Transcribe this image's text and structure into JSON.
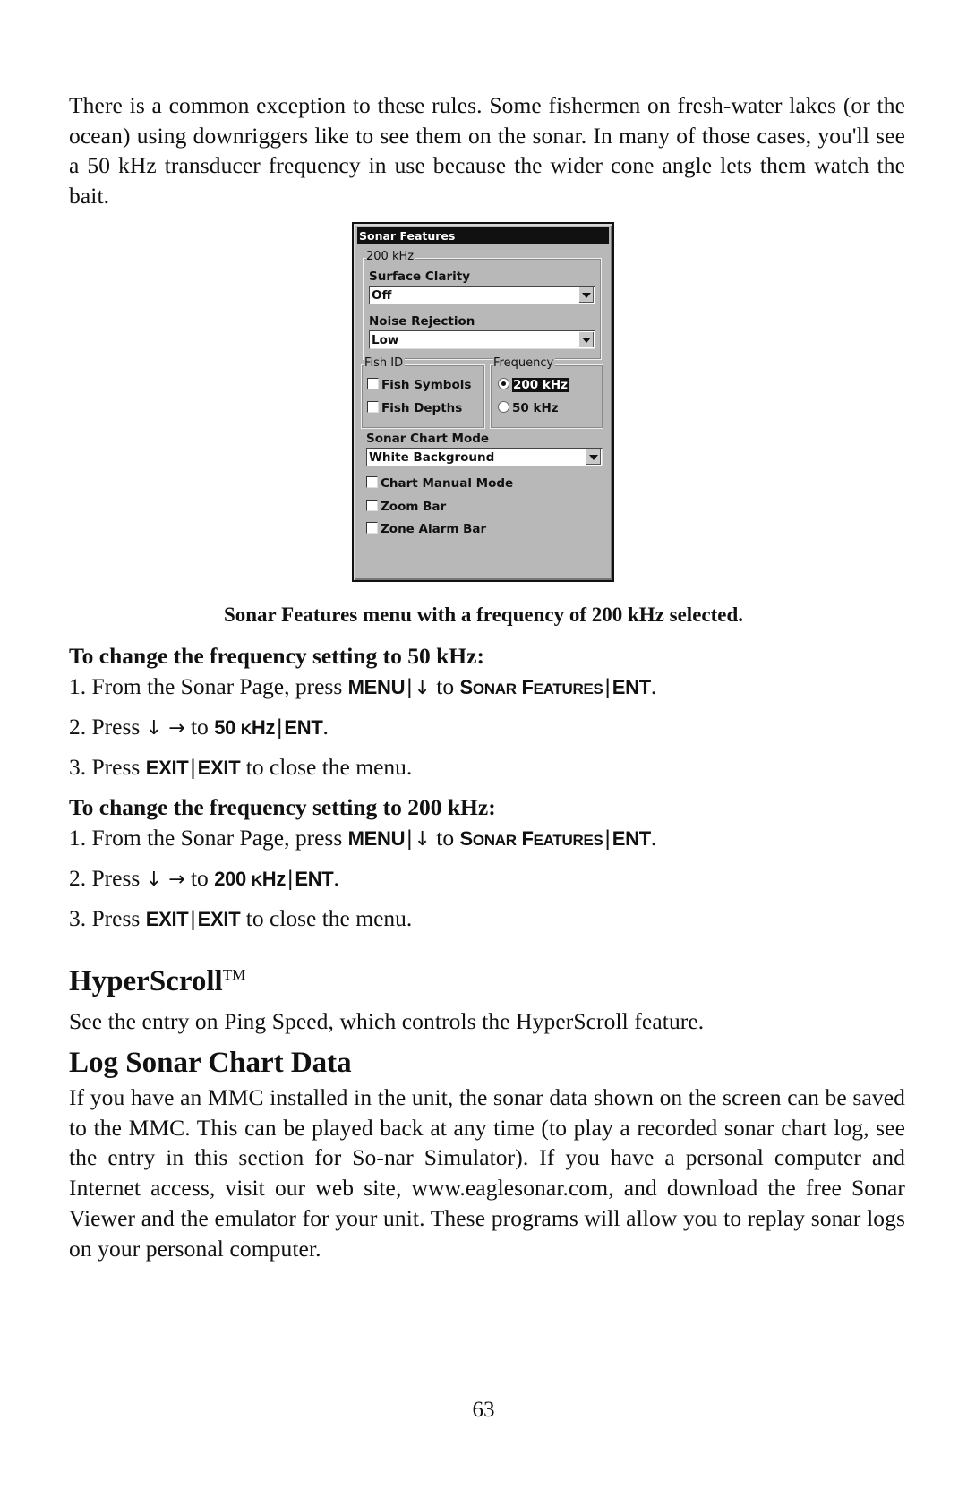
{
  "intro_paragraph": "There is a common exception to these rules. Some fishermen on fresh-water lakes (or the ocean) using downriggers like to see them on the sonar. In many of those cases, you'll see a 50 kHz transducer frequency in use because the wider cone angle lets them watch the bait.",
  "dialog": {
    "title": "Sonar Features",
    "group_200khz": {
      "label": "200 kHz",
      "surface_clarity": {
        "label": "Surface Clarity",
        "value": "Off"
      },
      "noise_rejection": {
        "label": "Noise Rejection",
        "value": "Low"
      }
    },
    "fish_id": {
      "label": "Fish ID",
      "items": [
        {
          "label": "Fish Symbols",
          "checked": false
        },
        {
          "label": "Fish Depths",
          "checked": false
        }
      ]
    },
    "frequency": {
      "label": "Frequency",
      "options": [
        {
          "label": "200 kHz",
          "selected": true
        },
        {
          "label": "50 kHz",
          "selected": false
        }
      ]
    },
    "sonar_chart_mode": {
      "label": "Sonar Chart Mode",
      "value": "White Background"
    },
    "checkboxes": [
      {
        "label": "Chart Manual Mode",
        "checked": false
      },
      {
        "label": "Zoom Bar",
        "checked": false
      },
      {
        "label": "Zone Alarm Bar",
        "checked": false
      }
    ]
  },
  "caption": "Sonar Features menu with a frequency of 200 kHz selected.",
  "procedures": [
    {
      "heading": "To change the frequency setting to 50 kHz:",
      "steps": [
        {
          "num": "1.",
          "pre": "From the Sonar Page, press",
          "key1": "MENU",
          "arrow": "↓",
          "mid": "to",
          "key2_cap": "S",
          "key2_sc": "ONAR",
          "key2_cap2": "F",
          "key2_sc2": "EATURES",
          "key3": "ENT",
          "end": "."
        },
        {
          "num": "2.",
          "pre": "Press",
          "arrows": "↓ →",
          "mid": "to",
          "key1": "50",
          "key1_sc": "KHZ",
          "key1_tail": "Hz",
          "key2": "ENT",
          "end": "."
        },
        {
          "num": "3.",
          "pre": "Press",
          "key1": "EXIT",
          "key2": "EXIT",
          "post": "to close the menu."
        }
      ]
    },
    {
      "heading": "To change the frequency setting to 200 kHz:",
      "steps": [
        {
          "num": "1.",
          "pre": "From the Sonar Page, press",
          "key1": "MENU",
          "arrow": "↓",
          "mid": "to",
          "key2_cap": "S",
          "key2_sc": "ONAR",
          "key2_cap2": "F",
          "key2_sc2": "EATURES",
          "key3": "ENT",
          "end": "."
        },
        {
          "num": "2.",
          "pre": "Press",
          "arrows": "↓ →",
          "mid": "to",
          "key1": "200",
          "key1_sc": "K",
          "key1_tail": "Hz",
          "key2": "ENT",
          "end": "."
        },
        {
          "num": "3.",
          "pre": "Press",
          "key1": "EXIT",
          "key2": "EXIT",
          "post": "to close the menu."
        }
      ]
    }
  ],
  "hyperscroll": {
    "heading": "HyperScroll",
    "tm": "TM",
    "body": "See the entry on Ping Speed, which controls the HyperScroll feature."
  },
  "log_sonar": {
    "heading": "Log Sonar Chart Data",
    "body": "If you have an MMC installed in the unit, the sonar data shown on the screen can be saved to the MMC. This can be played back at any time (to play a recorded sonar chart log, see the entry in this section for So-nar Simulator). If you have a personal computer and Internet access, visit our web site, www.eaglesonar.com, and download the free Sonar Viewer and the emulator for your unit. These programs will allow you to replay sonar logs on your personal computer."
  },
  "page_number": "63"
}
